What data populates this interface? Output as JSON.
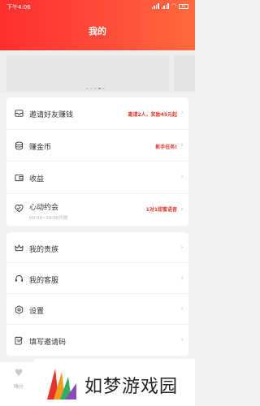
{
  "status_bar": {
    "time": "下午4:06",
    "battery": "81"
  },
  "header": {
    "title": "我的"
  },
  "menu_top": [
    {
      "key": "invite",
      "label": "邀请好友赚钱",
      "badge": "邀请2人，奖励45元起",
      "icon": "inbox-icon"
    },
    {
      "key": "coins",
      "label": "赚金币",
      "badge": "新手任务!",
      "icon": "coin-stack-icon"
    },
    {
      "key": "earnings",
      "label": "收益",
      "badge": "",
      "icon": "wallet-icon"
    },
    {
      "key": "date",
      "label": "心动约会",
      "sub": "00:09~24:00开放",
      "badge": "1对1甜蜜语音",
      "icon": "heart-icon"
    }
  ],
  "menu_bottom": [
    {
      "key": "noble",
      "label": "我的贵族",
      "icon": "crown-icon"
    },
    {
      "key": "service",
      "label": "我的客服",
      "icon": "headset-icon"
    },
    {
      "key": "settings",
      "label": "设置",
      "icon": "settings-icon"
    },
    {
      "key": "invite_code",
      "label": "填写邀请码",
      "icon": "edit-icon"
    }
  ],
  "tabbar": {
    "label": "嗨分"
  },
  "watermark": {
    "text": "如梦游戏园"
  },
  "colors": {
    "accent": "#e8362e",
    "header_start": "#ff2e2e",
    "header_end": "#ff6a3d"
  }
}
